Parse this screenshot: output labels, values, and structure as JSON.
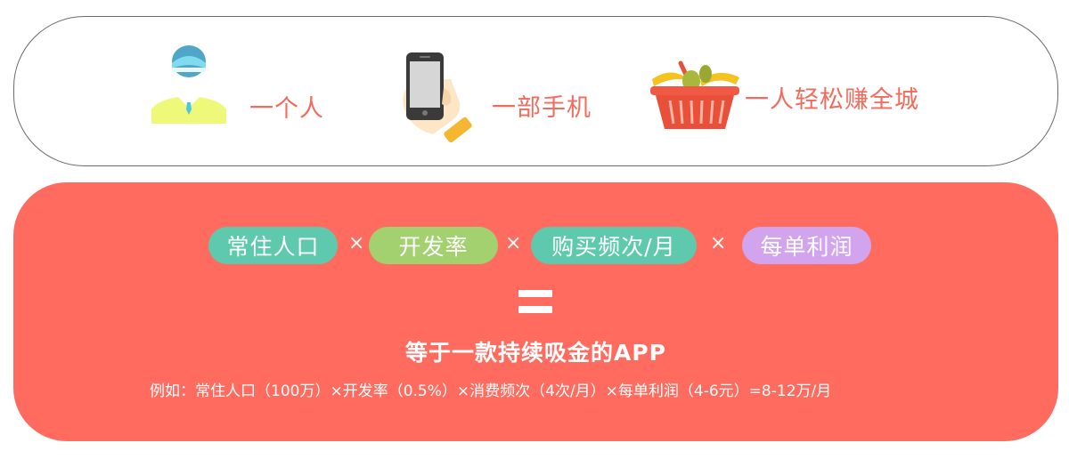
{
  "features": [
    {
      "label": "一个人",
      "icon": "person-icon"
    },
    {
      "label": "一部手机",
      "icon": "phone-icon"
    },
    {
      "label": "一人轻松赚全城",
      "icon": "basket-icon"
    }
  ],
  "formula_pills": [
    {
      "label": "常住人口",
      "color": "#5fc9ae"
    },
    {
      "label": "开发率",
      "color": "#a3d16f"
    },
    {
      "label": "购买频次/月",
      "color": "#5fc9ae"
    },
    {
      "label": "每单利润",
      "color": "#d2a4ee"
    }
  ],
  "operator_symbol": "×",
  "headline": "等于一款持续吸金的APP",
  "formula_example": "例如：常住人口（100万）×开发率（0.5%）×消费频次（4次/月）×每单利润（4-6元）=8-12万/月",
  "colors": {
    "accent": "#ff6b5f",
    "label": "#f26b5c"
  }
}
